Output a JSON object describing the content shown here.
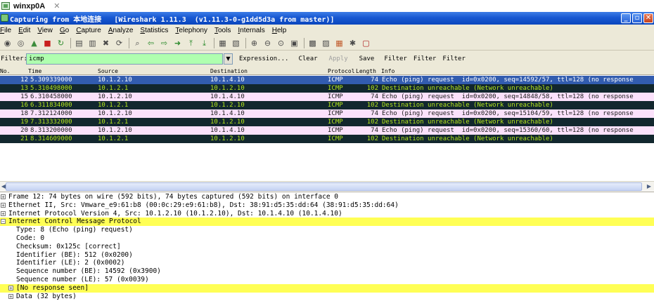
{
  "vm_tab": {
    "title": "winxp0A",
    "close": "✕"
  },
  "window": {
    "title": "Capturing from 本地连接   [Wireshark 1.11.3  (v1.11.3-0-g1dd5d3a from master)]"
  },
  "menu": [
    "File",
    "Edit",
    "View",
    "Go",
    "Capture",
    "Analyze",
    "Statistics",
    "Telephony",
    "Tools",
    "Internals",
    "Help"
  ],
  "toolbar_icons": [
    "interfaces-icon",
    "options-icon",
    "start-capture-icon",
    "stop-capture-icon",
    "restart-capture-icon",
    "open-icon",
    "save-icon",
    "close-file-icon",
    "reload-icon",
    "find-icon",
    "back-icon",
    "forward-icon",
    "goto-icon",
    "first-packet-icon",
    "last-packet-icon",
    "colorize-icon",
    "autoscroll-icon",
    "zoom-in-icon",
    "zoom-out-icon",
    "normal-size-icon",
    "resize-columns-icon",
    "capture-filters-icon",
    "display-filters-icon",
    "coloring-rules-icon",
    "preferences-icon",
    "help-icon"
  ],
  "filter": {
    "label": "Filter:",
    "value": "icmp",
    "buttons": [
      "Expression...",
      "Clear",
      "Apply",
      "Save",
      "Filter",
      "Filter",
      "Filter"
    ]
  },
  "packet_list": {
    "columns": [
      "No.",
      "Time",
      "Source",
      "Destination",
      "Protocol",
      "Length",
      "Info"
    ],
    "rows": [
      {
        "no": "12",
        "time": "5.309339000",
        "src": "10.1.2.10",
        "dst": "10.1.4.10",
        "proto": "ICMP",
        "len": "74",
        "info": "Echo (ping) request  id=0x0200, seq=14592/57, ttl=128 (no response",
        "style": "sel"
      },
      {
        "no": "13",
        "time": "5.310498000",
        "src": "10.1.2.1",
        "dst": "10.1.2.10",
        "proto": "ICMP",
        "len": "102",
        "info": "Destination unreachable (Network unreachable)",
        "style": "unreach"
      },
      {
        "no": "15",
        "time": "6.310458000",
        "src": "10.1.2.10",
        "dst": "10.1.4.10",
        "proto": "ICMP",
        "len": "74",
        "info": "Echo (ping) request  id=0x0200, seq=14848/58, ttl=128 (no response",
        "style": "echo"
      },
      {
        "no": "16",
        "time": "6.311834000",
        "src": "10.1.2.1",
        "dst": "10.1.2.10",
        "proto": "ICMP",
        "len": "102",
        "info": "Destination unreachable (Network unreachable)",
        "style": "unreach"
      },
      {
        "no": "18",
        "time": "7.312124000",
        "src": "10.1.2.10",
        "dst": "10.1.4.10",
        "proto": "ICMP",
        "len": "74",
        "info": "Echo (ping) request  id=0x0200, seq=15104/59, ttl=128 (no response",
        "style": "echo"
      },
      {
        "no": "19",
        "time": "7.313332000",
        "src": "10.1.2.1",
        "dst": "10.1.2.10",
        "proto": "ICMP",
        "len": "102",
        "info": "Destination unreachable (Network unreachable)",
        "style": "unreach"
      },
      {
        "no": "20",
        "time": "8.313200000",
        "src": "10.1.2.10",
        "dst": "10.1.4.10",
        "proto": "ICMP",
        "len": "74",
        "info": "Echo (ping) request  id=0x0200, seq=15360/60, ttl=128 (no response",
        "style": "echo"
      },
      {
        "no": "21",
        "time": "8.314609000",
        "src": "10.1.2.1",
        "dst": "10.1.2.10",
        "proto": "ICMP",
        "len": "102",
        "info": "Destination unreachable (Network unreachable)",
        "style": "unreach"
      }
    ]
  },
  "details": [
    {
      "text": "Frame 12: 74 bytes on wire (592 bits), 74 bytes captured (592 bits) on interface 0",
      "expander": "+",
      "indent": 0,
      "highlight": false
    },
    {
      "text": "Ethernet II, Src: Vmware_e9:61:b8 (00:0c:29:e9:61:b8), Dst: 38:91:d5:35:dd:64 (38:91:d5:35:dd:64)",
      "expander": "+",
      "indent": 0,
      "highlight": false
    },
    {
      "text": "Internet Protocol Version 4, Src: 10.1.2.10 (10.1.2.10), Dst: 10.1.4.10 (10.1.4.10)",
      "expander": "+",
      "indent": 0,
      "highlight": false
    },
    {
      "text": "Internet Control Message Protocol",
      "expander": "-",
      "indent": 0,
      "highlight": true
    },
    {
      "text": "Type: 8 (Echo (ping) request)",
      "expander": "",
      "indent": 1,
      "highlight": false
    },
    {
      "text": "Code: 0",
      "expander": "",
      "indent": 1,
      "highlight": false
    },
    {
      "text": "Checksum: 0x125c [correct]",
      "expander": "",
      "indent": 1,
      "highlight": false
    },
    {
      "text": "Identifier (BE): 512 (0x0200)",
      "expander": "",
      "indent": 1,
      "highlight": false
    },
    {
      "text": "Identifier (LE): 2 (0x0002)",
      "expander": "",
      "indent": 1,
      "highlight": false
    },
    {
      "text": "Sequence number (BE): 14592 (0x3900)",
      "expander": "",
      "indent": 1,
      "highlight": false
    },
    {
      "text": "Sequence number (LE): 57 (0x0039)",
      "expander": "",
      "indent": 1,
      "highlight": false
    },
    {
      "text": "[No response seen]",
      "expander": "+",
      "indent": 1,
      "highlight": true
    },
    {
      "text": "Data (32 bytes)",
      "expander": "+",
      "indent": 1,
      "highlight": false
    }
  ]
}
